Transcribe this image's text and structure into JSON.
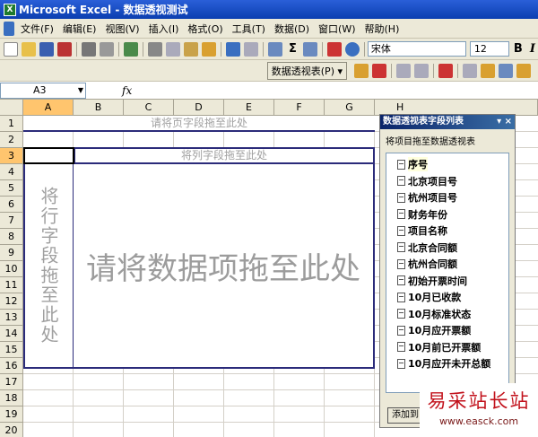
{
  "window": {
    "title": "Microsoft Excel - 数据透视测试",
    "app_icon_label": "X"
  },
  "menu": [
    "文件(F)",
    "编辑(E)",
    "视图(V)",
    "插入(I)",
    "格式(O)",
    "工具(T)",
    "数据(D)",
    "窗口(W)",
    "帮助(H)"
  ],
  "toolbar": {
    "font": "宋体",
    "font_size": "12",
    "bold_label": "B",
    "italic_label": "I",
    "sum_label": "Σ",
    "pivot_menu_label": "数据透视表(P) ▾"
  },
  "formula": {
    "name_box": "A3",
    "fx_label": "fx"
  },
  "columns": [
    "A",
    "B",
    "C",
    "D",
    "E",
    "F",
    "G",
    "H"
  ],
  "rows": [
    "1",
    "2",
    "3",
    "4",
    "5",
    "6",
    "7",
    "8",
    "9",
    "10",
    "11",
    "12",
    "13",
    "14",
    "15",
    "16",
    "17",
    "18",
    "19",
    "20"
  ],
  "pivot": {
    "page_zone": "请将页字段拖至此处",
    "column_zone": "将列字段拖至此处",
    "row_zone": "将行字段拖至此处",
    "data_zone": "请将数据项拖至此处"
  },
  "field_list": {
    "title": "数据透视表字段列表",
    "controls": "▾ ×",
    "instruction": "将项目拖至数据透视表",
    "fields": [
      "序号",
      "北京项目号",
      "杭州项目号",
      "财务年份",
      "项目名称",
      "北京合同额",
      "杭州合同额",
      "初始开票时间",
      "10月已收款",
      "10月标准状态",
      "10月应开票额",
      "10月前已开票额",
      "10月应开未开总额"
    ],
    "add_button": "添加到"
  },
  "watermark": {
    "text": "易采站长站",
    "url": "www.easck.com",
    "text_color": "#c2121c"
  },
  "colors": {
    "title_bar": "#0a246a",
    "selected_header": "#ffc56e",
    "pivot_border": "#2b2b7a",
    "zone_text": "#a0a0a0"
  }
}
